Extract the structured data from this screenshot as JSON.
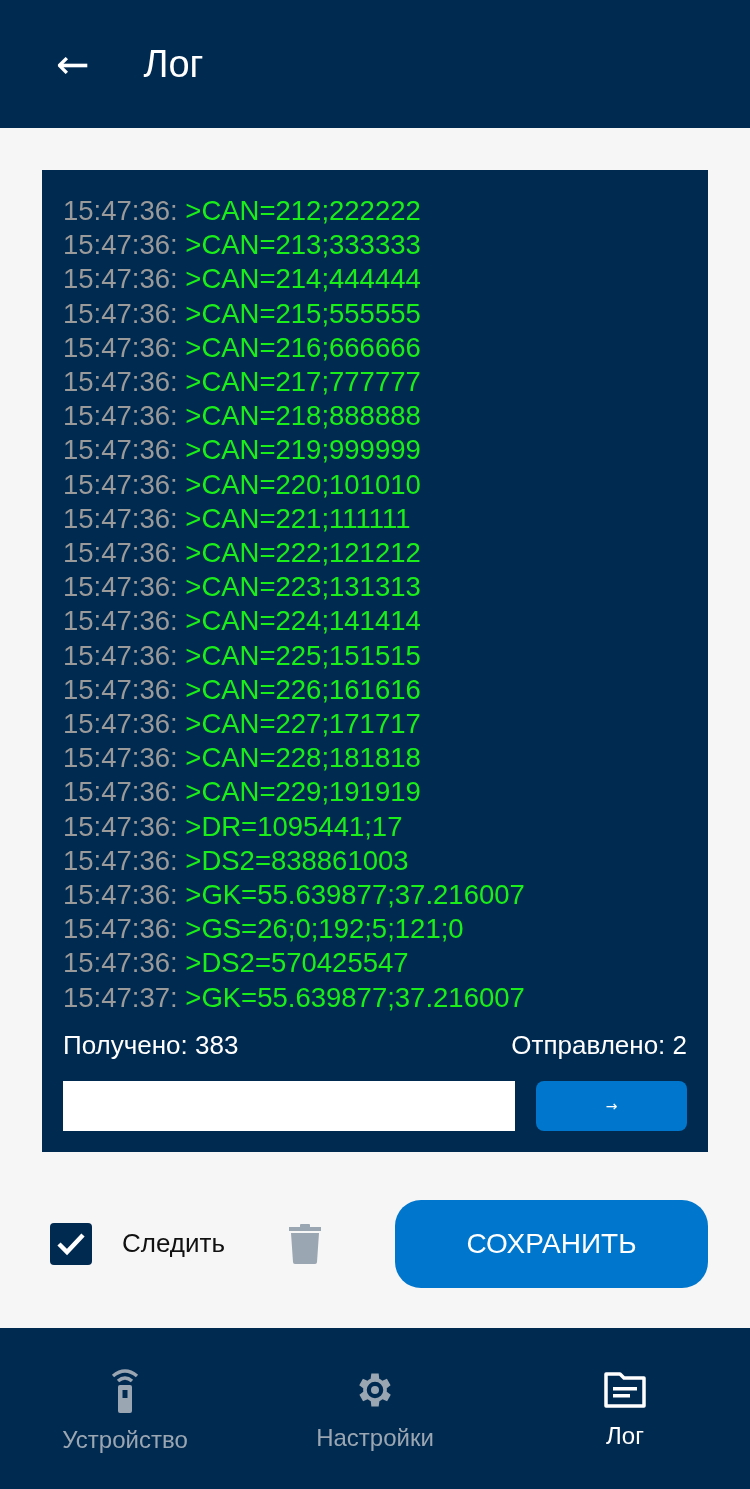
{
  "header": {
    "back": "←",
    "title": "Лог"
  },
  "log": [
    {
      "time": "15:47:36:",
      "message": ">CAN=212;222222"
    },
    {
      "time": "15:47:36:",
      "message": ">CAN=213;333333"
    },
    {
      "time": "15:47:36:",
      "message": ">CAN=214;444444"
    },
    {
      "time": "15:47:36:",
      "message": ">CAN=215;555555"
    },
    {
      "time": "15:47:36:",
      "message": ">CAN=216;666666"
    },
    {
      "time": "15:47:36:",
      "message": ">CAN=217;777777"
    },
    {
      "time": "15:47:36:",
      "message": ">CAN=218;888888"
    },
    {
      "time": "15:47:36:",
      "message": ">CAN=219;999999"
    },
    {
      "time": "15:47:36:",
      "message": ">CAN=220;101010"
    },
    {
      "time": "15:47:36:",
      "message": ">CAN=221;111111"
    },
    {
      "time": "15:47:36:",
      "message": ">CAN=222;121212"
    },
    {
      "time": "15:47:36:",
      "message": ">CAN=223;131313"
    },
    {
      "time": "15:47:36:",
      "message": ">CAN=224;141414"
    },
    {
      "time": "15:47:36:",
      "message": ">CAN=225;151515"
    },
    {
      "time": "15:47:36:",
      "message": ">CAN=226;161616"
    },
    {
      "time": "15:47:36:",
      "message": ">CAN=227;171717"
    },
    {
      "time": "15:47:36:",
      "message": ">CAN=228;181818"
    },
    {
      "time": "15:47:36:",
      "message": ">CAN=229;191919"
    },
    {
      "time": "15:47:36:",
      "message": ">DR=1095441;17"
    },
    {
      "time": "15:47:36:",
      "message": ">DS2=838861003"
    },
    {
      "time": "15:47:36:",
      "message": ">GK=55.639877;37.216007"
    },
    {
      "time": "15:47:36:",
      "message": ">GS=26;0;192;5;121;0"
    },
    {
      "time": "15:47:36:",
      "message": ">DS2=570425547"
    },
    {
      "time": "15:47:37:",
      "message": ">GK=55.639877;37.216007"
    }
  ],
  "received": "Получено: 383",
  "sent": "Отправлено: 2",
  "send_button": "→",
  "follow": {
    "label": "Следить",
    "checked": true
  },
  "save_button": "СОХРАНИТЬ",
  "nav": [
    {
      "kind": "device",
      "label": "Устройство",
      "selected": false
    },
    {
      "kind": "settings",
      "label": "Настройки",
      "selected": false
    },
    {
      "kind": "log",
      "label": "Лог",
      "selected": true
    }
  ]
}
